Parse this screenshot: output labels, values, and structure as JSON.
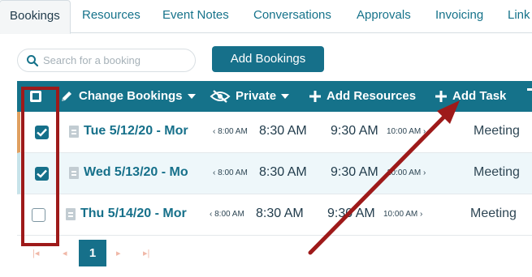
{
  "tabs": [
    {
      "label": "Bookings",
      "active": true
    },
    {
      "label": "Resources"
    },
    {
      "label": "Event Notes"
    },
    {
      "label": "Conversations"
    },
    {
      "label": "Approvals"
    },
    {
      "label": "Invoicing"
    },
    {
      "label": "Link"
    }
  ],
  "search": {
    "placeholder": "Search for a booking"
  },
  "add_bookings_label": "Add Bookings",
  "toolbar": {
    "change_bookings": "Change Bookings",
    "private": "Private",
    "add_resources": "Add Resources",
    "add_task": "Add Task"
  },
  "rows": [
    {
      "checked": true,
      "date": "Tue 5/12/20 - Mor",
      "setup": "8:00 AM",
      "start": "8:30 AM",
      "end": "9:30 AM",
      "teardown": "10:00 AM",
      "type": "Meeting"
    },
    {
      "checked": true,
      "date": "Wed 5/13/20 - Mo",
      "setup": "8:00 AM",
      "start": "8:30 AM",
      "end": "9:30 AM",
      "teardown": "10:00 AM",
      "type": "Meeting"
    },
    {
      "checked": false,
      "date": "Thu 5/14/20 - Mor",
      "setup": "8:00 AM",
      "start": "8:30 AM",
      "end": "9:30 AM",
      "teardown": "10:00 AM",
      "type": "Meeting"
    }
  ],
  "pagination": {
    "current_page": "1"
  },
  "colors": {
    "accent": "#16708a",
    "highlight": "#9e1a1a"
  }
}
